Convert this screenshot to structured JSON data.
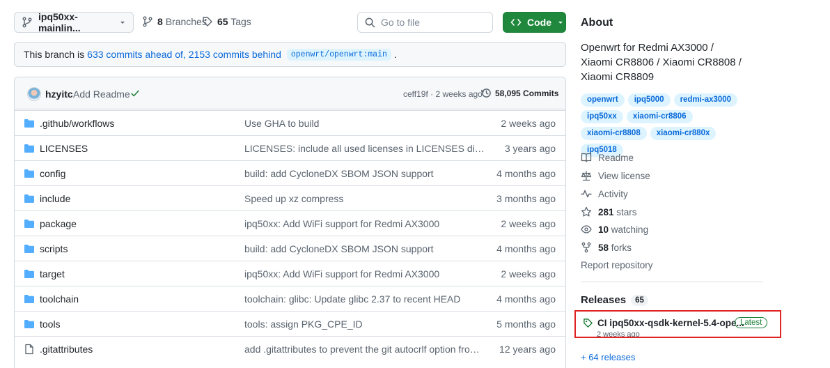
{
  "top": {
    "branch": "ipq50xx-mainlin...",
    "branches_count": "8",
    "branches_label": "Branches",
    "tags_count": "65",
    "tags_label": "Tags",
    "goto_placeholder": "Go to file",
    "code_label": "Code"
  },
  "ahead": {
    "prefix": "This branch is",
    "ahead_text": "633 commits ahead of,",
    "behind_text": "2153 commits behind",
    "upstream": "openwrt/openwrt:main",
    "suffix": "."
  },
  "latest_commit": {
    "author": "hzyitc",
    "message": "Add Readme",
    "meta": "ceff19f · 2 weeks ago",
    "commits": "58,095 Commits"
  },
  "files": [
    {
      "name": ".github/workflows",
      "type": "folder",
      "message": "Use GHA to build",
      "age": "2 weeks ago"
    },
    {
      "name": "LICENSES",
      "type": "folder",
      "message": "LICENSES: include all used licenses in LICENSES directory",
      "age": "3 years ago"
    },
    {
      "name": "config",
      "type": "folder",
      "message": "build: add CycloneDX SBOM JSON support",
      "age": "4 months ago"
    },
    {
      "name": "include",
      "type": "folder",
      "message": "Speed up xz compress",
      "age": "3 months ago"
    },
    {
      "name": "package",
      "type": "folder",
      "message": "ipq50xx: Add WiFi support for Redmi AX3000",
      "age": "2 weeks ago"
    },
    {
      "name": "scripts",
      "type": "folder",
      "message": "build: add CycloneDX SBOM JSON support",
      "age": "4 months ago"
    },
    {
      "name": "target",
      "type": "folder",
      "message": "ipq50xx: Add WiFi support for Redmi AX3000",
      "age": "2 weeks ago"
    },
    {
      "name": "toolchain",
      "type": "folder",
      "message": "toolchain: glibc: Update glibc 2.37 to recent HEAD",
      "age": "4 months ago"
    },
    {
      "name": "tools",
      "type": "folder",
      "message": "tools: assign PKG_CPE_ID",
      "age": "5 months ago"
    },
    {
      "name": ".gitattributes",
      "type": "file",
      "message": "add .gitattributes to prevent the git autocrlf option from me...",
      "age": "12 years ago"
    }
  ],
  "about": {
    "title": "About",
    "description": "Openwrt for Redmi AX3000 / Xiaomi CR8806 / Xiaomi CR8808 / Xiaomi CR8809",
    "topics": [
      "openwrt",
      "ipq5000",
      "redmi-ax3000",
      "ipq50xx",
      "xiaomi-cr8806",
      "xiaomi-cr8808",
      "xiaomi-cr880x",
      "ipq5018"
    ],
    "readme": "Readme",
    "license": "View license",
    "activity": "Activity",
    "stars_count": "281",
    "stars_label": "stars",
    "watching_count": "10",
    "watching_label": "watching",
    "forks_count": "58",
    "forks_label": "forks",
    "report": "Report repository"
  },
  "releases": {
    "title": "Releases",
    "count": "65",
    "latest_name": "CI ipq50xx-qsdk-kernel-5.4-ope...",
    "latest_badge": "Latest",
    "latest_time": "2 weeks ago",
    "more": "+ 64 releases"
  }
}
